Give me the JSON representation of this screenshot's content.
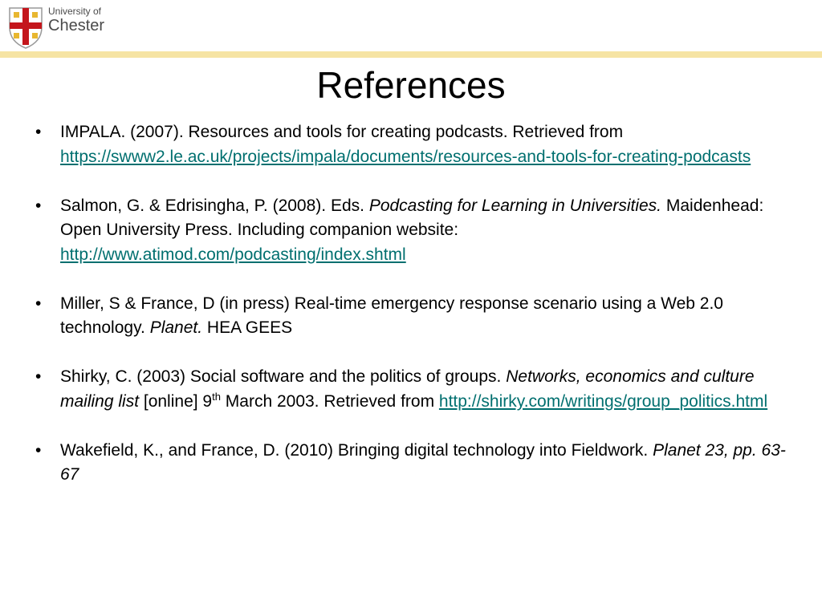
{
  "logo": {
    "line1": "University of",
    "line2": "Chester"
  },
  "colors": {
    "header_bar": "#f6e4a4",
    "link": "#006f6f",
    "crest_red": "#c4161c",
    "crest_gold": "#e8b730"
  },
  "title": "References",
  "references": [
    {
      "text": "IMPALA. (2007). Resources and tools for creating podcasts. Retrieved from ",
      "link": "https://swww2.le.ac.uk/projects/impala/documents/resources-and-tools-for-creating-podcasts"
    },
    {
      "text1": "Salmon, G. & Edrisingha, P. (2008). Eds. ",
      "italic": "Podcasting for Learning in Universities.",
      "text2": " Maidenhead: Open University Press. Including companion website: ",
      "link": "http://www.atimod.com/podcasting/index.shtml"
    },
    {
      "text1": "Miller, S & France, D (in press) Real-time emergency response scenario using a Web 2.0 technology. ",
      "italic": "Planet.",
      "text2": " HEA GEES"
    },
    {
      "text1": "Shirky, C. (2003) Social software and the politics of groups. ",
      "italic": "Networks, economics and culture mailing list",
      "text2": " [online] 9",
      "sup": "th",
      "text3": " March 2003. Retrieved from ",
      "link": "http://shirky.com/writings/group_politics.html"
    },
    {
      "text1": "Wakefield, K., and France, D. (2010) Bringing digital technology into Fieldwork. ",
      "italic": "Planet 23, pp. 63- 67"
    }
  ]
}
